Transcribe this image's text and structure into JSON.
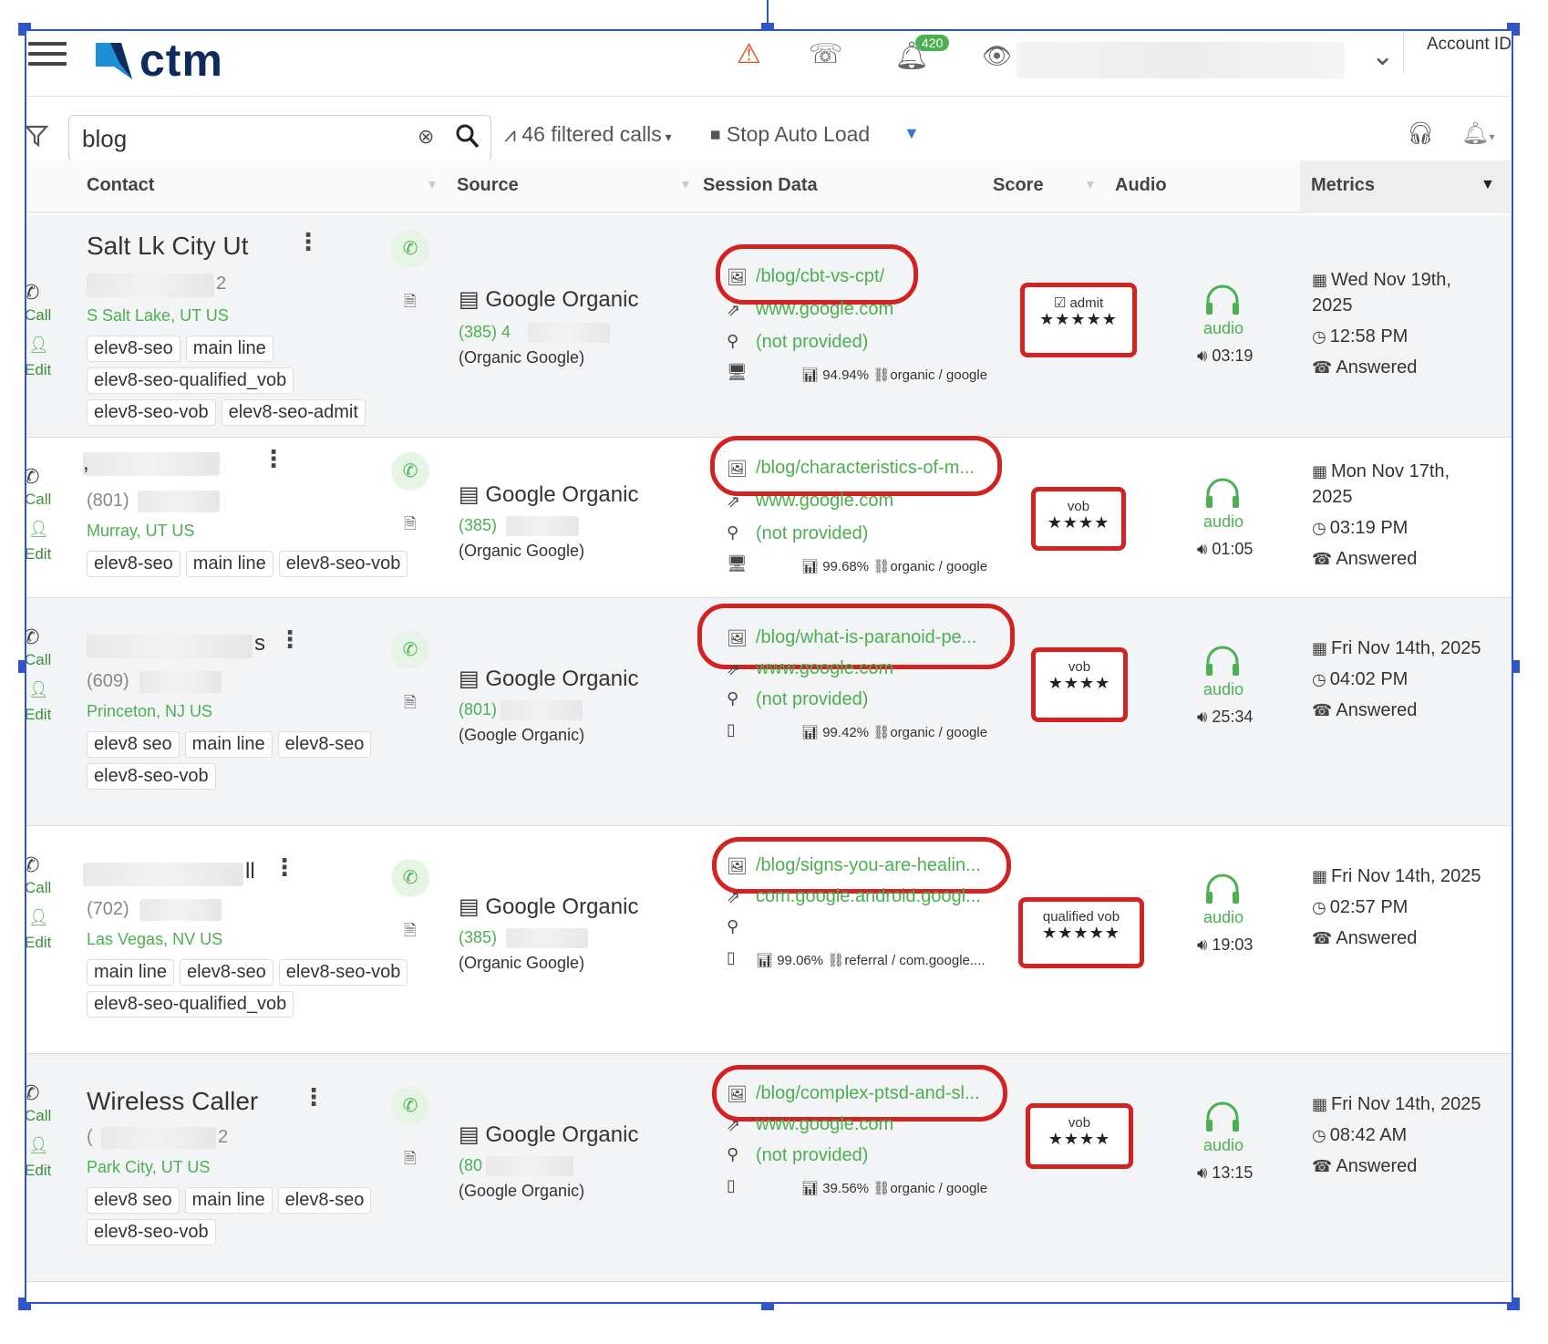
{
  "app": {
    "logo_text": "ctm",
    "notification_count": "420",
    "account_label": "Account ID"
  },
  "toolbar": {
    "search_value": "blog",
    "filtered_calls": "46 filtered calls",
    "stop_auto_load": "Stop Auto Load"
  },
  "columns": {
    "contact": "Contact",
    "source": "Source",
    "session_data": "Session Data",
    "score": "Score",
    "audio": "Audio",
    "metrics": "Metrics"
  },
  "side_actions": {
    "call": "Call",
    "edit": "Edit"
  },
  "audio_label": "audio",
  "calls": [
    {
      "name": "Salt Lk City Ut",
      "phone": "2",
      "location_city": "S Salt Lake",
      "location_rest": ", UT US",
      "tags": [
        "elev8-seo",
        "main line",
        "elev8-seo-qualified_vob",
        "elev8-seo-vob",
        "elev8-seo-admit"
      ],
      "source_title": "Google Organic",
      "source_phone": "(385) 4",
      "source_sub": "(Organic Google)",
      "page": "/blog/cbt-vs-cpt/",
      "referrer": "www.google.com",
      "keyword": "(not provided)",
      "device": "desktop",
      "percent": "94.94%",
      "medium": "organic / google",
      "score_label": "admit",
      "stars": "★★★★★",
      "audio_duration": "03:19",
      "date_line1": "Wed Nov 19th,",
      "date_line2": "2025",
      "time": "12:58 PM",
      "status": "Answered"
    },
    {
      "name": ",",
      "phone": "(801)",
      "location_city": "Murray",
      "location_rest": ", UT US",
      "tags": [
        "elev8-seo",
        "main line",
        "elev8-seo-vob"
      ],
      "source_title": "Google Organic",
      "source_phone": "(385)",
      "source_sub": "(Organic Google)",
      "page": "/blog/characteristics-of-m...",
      "referrer": "www.google.com",
      "keyword": "(not provided)",
      "device": "desktop",
      "percent": "99.68%",
      "medium": "organic / google",
      "score_label": "vob",
      "stars": "★★★★",
      "audio_duration": "01:05",
      "date_line1": "Mon Nov 17th,",
      "date_line2": "2025",
      "time": "03:19 PM",
      "status": "Answered"
    },
    {
      "name": "s",
      "phone": "(609)",
      "location_city": "Princeton",
      "location_rest": ", NJ US",
      "tags": [
        "elev8 seo",
        "main line",
        "elev8-seo",
        "elev8-seo-vob"
      ],
      "source_title": "Google Organic",
      "source_phone": "(801)",
      "source_sub": "(Google Organic)",
      "page": "/blog/what-is-paranoid-pe...",
      "referrer": "www.google.com",
      "keyword": "(not provided)",
      "device": "mobile",
      "percent": "99.42%",
      "medium": "organic / google",
      "score_label": "vob",
      "stars": "★★★★",
      "audio_duration": "25:34",
      "date_line1": "Fri Nov 14th, 2025",
      "date_line2": "",
      "time": "04:02 PM",
      "status": "Answered"
    },
    {
      "name": "ll",
      "phone": "(702)",
      "location_city": "Las Vegas",
      "location_rest": ", NV US",
      "tags": [
        "main line",
        "elev8-seo",
        "elev8-seo-vob",
        "elev8-seo-qualified_vob"
      ],
      "source_title": "Google Organic",
      "source_phone": "(385)",
      "source_sub": "(Organic Google)",
      "page": "/blog/signs-you-are-healin...",
      "referrer": "com.google.android.googl...",
      "keyword": "",
      "device": "mobile",
      "percent": "99.06%",
      "medium": "referral / com.google....",
      "score_label": "qualified vob",
      "stars": "★★★★★",
      "audio_duration": "19:03",
      "date_line1": "Fri Nov 14th, 2025",
      "date_line2": "",
      "time": "02:57 PM",
      "status": "Answered"
    },
    {
      "name": "Wireless Caller",
      "phone": "(",
      "phone_end": "2",
      "location_city": "Park City",
      "location_rest": ", UT US",
      "tags": [
        "elev8 seo",
        "main line",
        "elev8-seo",
        "elev8-seo-vob"
      ],
      "source_title": "Google Organic",
      "source_phone": "(80",
      "source_sub": "(Google Organic)",
      "page": "/blog/complex-ptsd-and-sl...",
      "referrer": "www.google.com",
      "keyword": "(not provided)",
      "device": "mobile",
      "percent": "39.56%",
      "medium": "organic / google",
      "score_label": "vob",
      "stars": "★★★★",
      "audio_duration": "13:15",
      "date_line1": "Fri Nov 14th, 2025",
      "date_line2": "",
      "time": "08:42 AM",
      "status": "Answered"
    }
  ]
}
